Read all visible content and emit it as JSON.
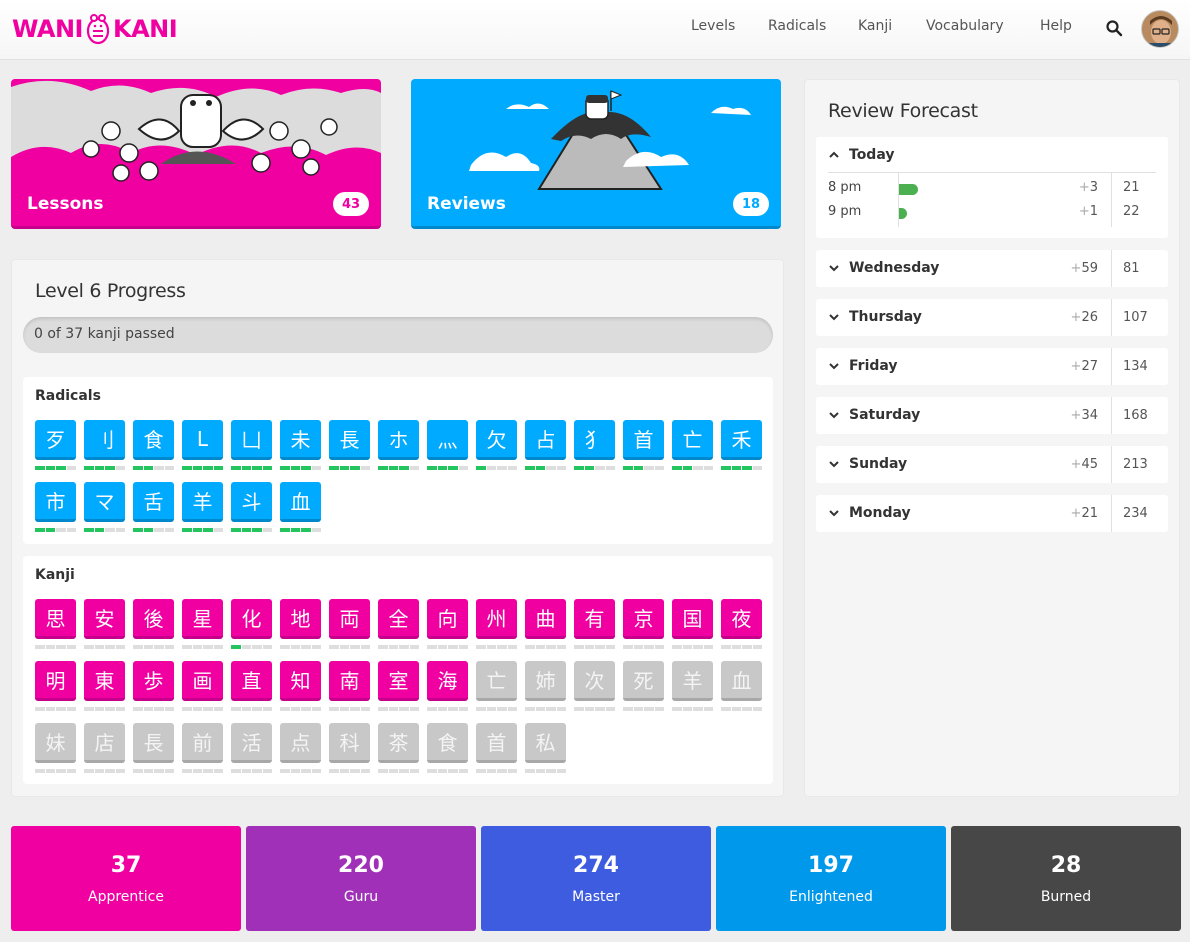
{
  "header": {
    "logo_left": "WANI",
    "logo_right": "KANI",
    "nav": [
      "Levels",
      "Radicals",
      "Kanji",
      "Vocabulary",
      "Help"
    ]
  },
  "lessons": {
    "label": "Lessons",
    "count": "43"
  },
  "reviews": {
    "label": "Reviews",
    "count": "18"
  },
  "progress": {
    "title": "Level 6 Progress",
    "bar_text": "0 of 37 kanji passed",
    "radicals_title": "Radicals",
    "kanji_title": "Kanji",
    "radicals": [
      {
        "char": "歹",
        "srs": 3
      },
      {
        "char": "刂",
        "srs": 3
      },
      {
        "char": "食",
        "srs": 2
      },
      {
        "char": "L",
        "srs": 4
      },
      {
        "char": "凵",
        "srs": 4
      },
      {
        "char": "未",
        "srs": 3
      },
      {
        "char": "長",
        "srs": 3
      },
      {
        "char": "ホ",
        "srs": 3
      },
      {
        "char": "灬",
        "srs": 3
      },
      {
        "char": "欠",
        "srs": 1
      },
      {
        "char": "占",
        "srs": 2
      },
      {
        "char": "犭",
        "srs": 2
      },
      {
        "char": "首",
        "srs": 2
      },
      {
        "char": "亡",
        "srs": 2
      },
      {
        "char": "禾",
        "srs": 3
      },
      {
        "char": "市",
        "srs": 2
      },
      {
        "char": "マ",
        "srs": 2
      },
      {
        "char": "舌",
        "srs": 2
      },
      {
        "char": "羊",
        "srs": 3
      },
      {
        "char": "斗",
        "srs": 3
      },
      {
        "char": "血",
        "srs": 3
      }
    ],
    "kanji": [
      {
        "char": "思",
        "srs": 0,
        "locked": false
      },
      {
        "char": "安",
        "srs": 0,
        "locked": false
      },
      {
        "char": "後",
        "srs": 0,
        "locked": false
      },
      {
        "char": "星",
        "srs": 0,
        "locked": false
      },
      {
        "char": "化",
        "srs": 1,
        "locked": false
      },
      {
        "char": "地",
        "srs": 0,
        "locked": false
      },
      {
        "char": "両",
        "srs": 0,
        "locked": false
      },
      {
        "char": "全",
        "srs": 0,
        "locked": false
      },
      {
        "char": "向",
        "srs": 0,
        "locked": false
      },
      {
        "char": "州",
        "srs": 0,
        "locked": false
      },
      {
        "char": "曲",
        "srs": 0,
        "locked": false
      },
      {
        "char": "有",
        "srs": 0,
        "locked": false
      },
      {
        "char": "京",
        "srs": 0,
        "locked": false
      },
      {
        "char": "国",
        "srs": 0,
        "locked": false
      },
      {
        "char": "夜",
        "srs": 0,
        "locked": false
      },
      {
        "char": "明",
        "srs": 0,
        "locked": false
      },
      {
        "char": "東",
        "srs": 0,
        "locked": false
      },
      {
        "char": "歩",
        "srs": 0,
        "locked": false
      },
      {
        "char": "画",
        "srs": 0,
        "locked": false
      },
      {
        "char": "直",
        "srs": 0,
        "locked": false
      },
      {
        "char": "知",
        "srs": 0,
        "locked": false
      },
      {
        "char": "南",
        "srs": 0,
        "locked": false
      },
      {
        "char": "室",
        "srs": 0,
        "locked": false
      },
      {
        "char": "海",
        "srs": 0,
        "locked": false
      },
      {
        "char": "亡",
        "srs": 0,
        "locked": true
      },
      {
        "char": "姉",
        "srs": 0,
        "locked": true
      },
      {
        "char": "次",
        "srs": 0,
        "locked": true
      },
      {
        "char": "死",
        "srs": 0,
        "locked": true
      },
      {
        "char": "羊",
        "srs": 0,
        "locked": true
      },
      {
        "char": "血",
        "srs": 0,
        "locked": true
      },
      {
        "char": "妹",
        "srs": 0,
        "locked": true
      },
      {
        "char": "店",
        "srs": 0,
        "locked": true
      },
      {
        "char": "長",
        "srs": 0,
        "locked": true
      },
      {
        "char": "前",
        "srs": 0,
        "locked": true
      },
      {
        "char": "活",
        "srs": 0,
        "locked": true
      },
      {
        "char": "点",
        "srs": 0,
        "locked": true
      },
      {
        "char": "科",
        "srs": 0,
        "locked": true
      },
      {
        "char": "茶",
        "srs": 0,
        "locked": true
      },
      {
        "char": "食",
        "srs": 0,
        "locked": true
      },
      {
        "char": "首",
        "srs": 0,
        "locked": true
      },
      {
        "char": "私",
        "srs": 0,
        "locked": true
      }
    ]
  },
  "forecast": {
    "title": "Review Forecast",
    "today": {
      "label": "Today",
      "rows": [
        {
          "time": "8 pm",
          "added": "3",
          "total": "21",
          "bar_fraction": 1.0
        },
        {
          "time": "9 pm",
          "added": "1",
          "total": "22",
          "bar_fraction": 0.4
        }
      ]
    },
    "days": [
      {
        "label": "Wednesday",
        "added": "59",
        "total": "81"
      },
      {
        "label": "Thursday",
        "added": "26",
        "total": "107"
      },
      {
        "label": "Friday",
        "added": "27",
        "total": "134"
      },
      {
        "label": "Saturday",
        "added": "34",
        "total": "168"
      },
      {
        "label": "Sunday",
        "added": "45",
        "total": "213"
      },
      {
        "label": "Monday",
        "added": "21",
        "total": "234"
      }
    ]
  },
  "stats": [
    {
      "value": "37",
      "label": "Apprentice",
      "color": "#f100a1"
    },
    {
      "value": "220",
      "label": "Guru",
      "color": "#a030b8"
    },
    {
      "value": "274",
      "label": "Master",
      "color": "#3d5ce0"
    },
    {
      "value": "197",
      "label": "Enlightened",
      "color": "#0098ea"
    },
    {
      "value": "28",
      "label": "Burned",
      "color": "#474747"
    }
  ],
  "colors": {
    "radical": "#00aaff",
    "kanji": "#f100a1",
    "locked": "#c8c8c8",
    "srs_on": "#22c55e"
  }
}
